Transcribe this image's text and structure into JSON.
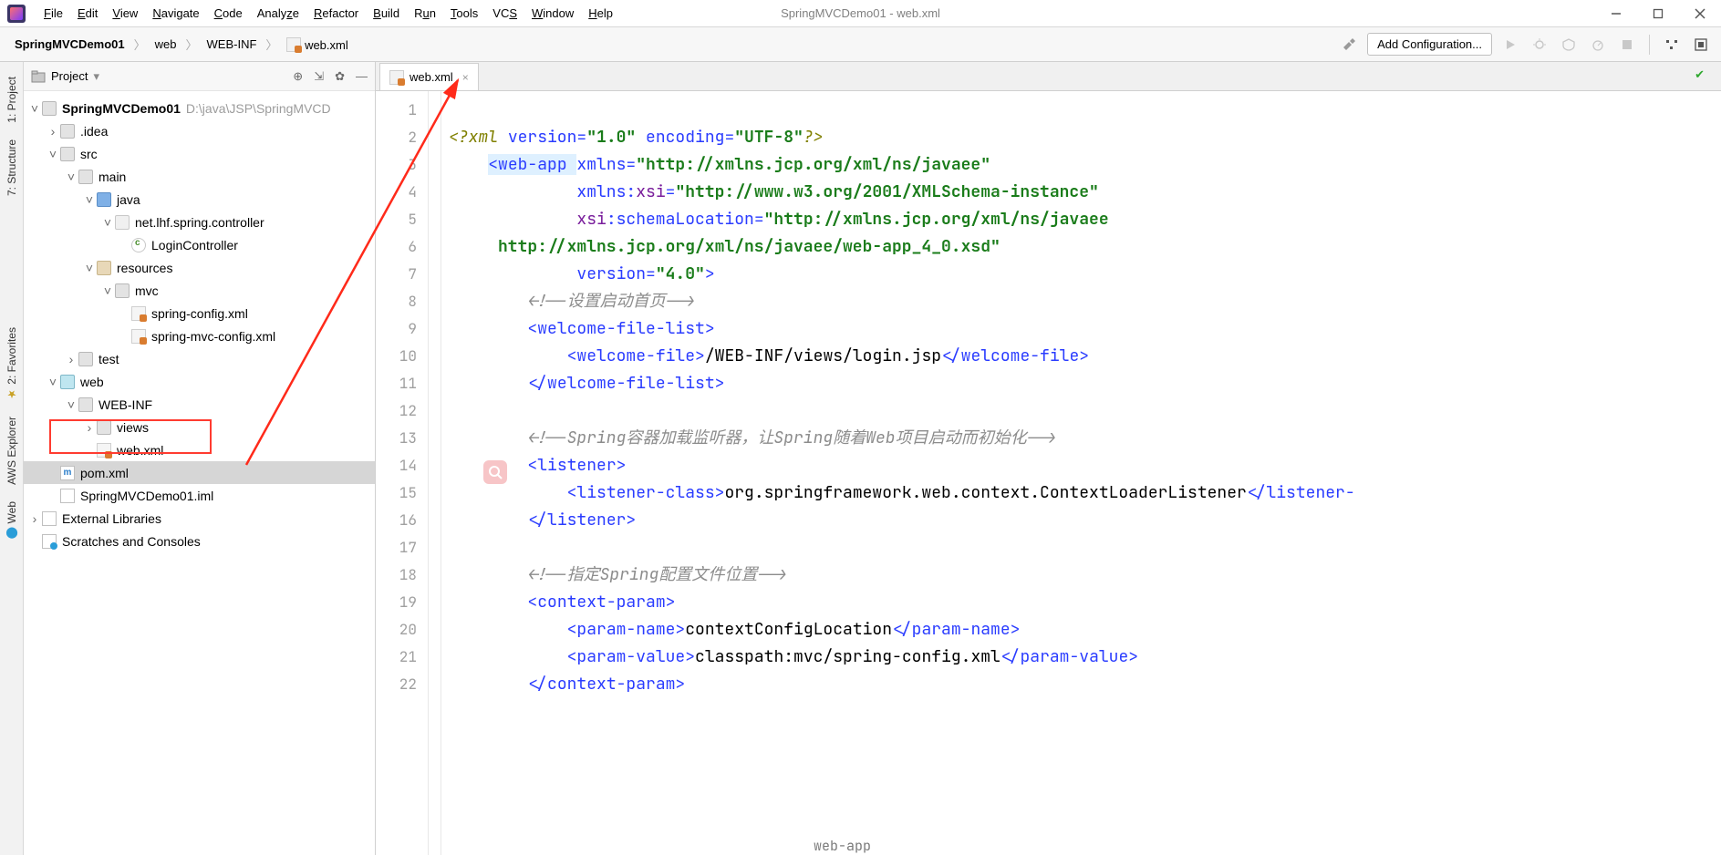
{
  "title": "SpringMVCDemo01 - web.xml",
  "menu": [
    "File",
    "Edit",
    "View",
    "Navigate",
    "Code",
    "Analyze",
    "Refactor",
    "Build",
    "Run",
    "Tools",
    "VCS",
    "Window",
    "Help"
  ],
  "breadcrumb": [
    "SpringMVCDemo01",
    "web",
    "WEB-INF",
    "web.xml"
  ],
  "addConfig": "Add Configuration...",
  "leftTabs": [
    "1: Project",
    "7: Structure",
    "2: Favorites",
    "AWS Explorer",
    "Web"
  ],
  "projectHeaderLabel": "Project",
  "tree": {
    "root": "SpringMVCDemo01",
    "rootPath": "D:\\java\\JSP\\SpringMVCD",
    "idea": ".idea",
    "src": "src",
    "main": "main",
    "java": "java",
    "pkg": "net.lhf.spring.controller",
    "cls": "LoginController",
    "resources": "resources",
    "mvc": "mvc",
    "springCfg": "spring-config.xml",
    "springMvcCfg": "spring-mvc-config.xml",
    "test": "test",
    "web": "web",
    "webinf": "WEB-INF",
    "views": "views",
    "webxml": "web.xml",
    "pom": "pom.xml",
    "iml": "SpringMVCDemo01.iml",
    "extLib": "External Libraries",
    "scratches": "Scratches and Consoles"
  },
  "editorTab": "web.xml",
  "lineNumbers": [
    "1",
    "2",
    "3",
    "4",
    "5",
    "6",
    "7",
    "8",
    "9",
    "10",
    "11",
    "12",
    "13",
    "14",
    "15",
    "16",
    "17",
    "18",
    "19",
    "20",
    "21",
    "22"
  ],
  "code": {
    "l1_a": "<?xml ",
    "l1_b": "version",
    "l1_c": "=",
    "l1_d": "\"1.0\"",
    "l1_e": " encoding",
    "l1_f": "=",
    "l1_g": "\"UTF-8\"",
    "l1_h": "?>",
    "l2_a": "<",
    "l2_b": "web-app ",
    "l2_c": "xmlns",
    "l2_d": "=",
    "l2_e": "\"http://xmlns.jcp.org/xml/ns/javaee\"",
    "l3_a": "xmlns:",
    "l3_b": "xsi",
    "l3_c": "=",
    "l3_d": "\"http://www.w3.org/2001/XMLSchema-instance\"",
    "l4_a": "xsi",
    "l4_b": ":schemaLocation",
    "l4_c": "=",
    "l4_d": "\"http://xmlns.jcp.org/xml/ns/javaee",
    "l5_a": "http://xmlns.jcp.org/xml/ns/javaee/web-app_4_0.xsd\"",
    "l6_a": "version",
    "l6_b": "=",
    "l6_c": "\"4.0\"",
    "l6_d": ">",
    "l7": "<!--设置启动首页-->",
    "l8_a": "<",
    "l8_b": "welcome-file-list",
    "l8_c": ">",
    "l9_a": "<",
    "l9_b": "welcome-file",
    "l9_c": ">",
    "l9_d": "/WEB-INF/views/login.jsp",
    "l9_e": "</",
    "l9_f": "welcome-file",
    "l9_g": ">",
    "l10_a": "</",
    "l10_b": "welcome-file-list",
    "l10_c": ">",
    "l12": "<!--Spring容器加载监听器，让Spring随着Web项目启动而初始化-->",
    "l13_a": "<",
    "l13_b": "listener",
    "l13_c": ">",
    "l14_a": "<",
    "l14_b": "listener-class",
    "l14_c": ">",
    "l14_d": "org.springframework.web.context.ContextLoaderListener",
    "l14_e": "</",
    "l14_f": "listener-",
    "l15_a": "</",
    "l15_b": "listener",
    "l15_c": ">",
    "l17": "<!--指定Spring配置文件位置-->",
    "l18_a": "<",
    "l18_b": "context-param",
    "l18_c": ">",
    "l19_a": "<",
    "l19_b": "param-name",
    "l19_c": ">",
    "l19_d": "contextConfigLocation",
    "l19_e": "</",
    "l19_f": "param-name",
    "l19_g": ">",
    "l20_a": "<",
    "l20_b": "param-value",
    "l20_c": ">",
    "l20_d": "classpath:mvc/spring-config.xml",
    "l20_e": "</",
    "l20_f": "param-value",
    "l20_g": ">",
    "l21_a": "</",
    "l21_b": "context-param",
    "l21_c": ">"
  },
  "bottomBreadcrumb": "web-app"
}
